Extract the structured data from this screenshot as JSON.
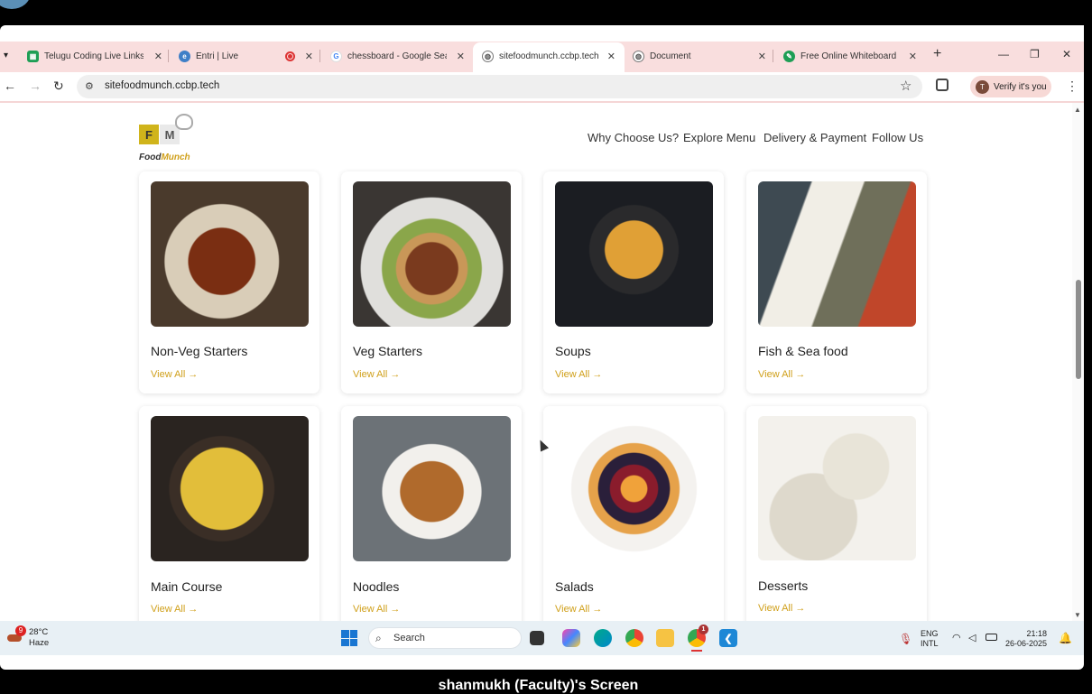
{
  "browser": {
    "tabs": [
      {
        "title": "Telugu Coding Live Links S"
      },
      {
        "title": "Entri | Live"
      },
      {
        "title": "chessboard - Google Searc"
      },
      {
        "title": "sitefoodmunch.ccbp.tech"
      },
      {
        "title": "Document"
      },
      {
        "title": "Free Online Whiteboard"
      }
    ],
    "new_tab": "+",
    "url": "sitefoodmunch.ccbp.tech",
    "profile_initial": "T",
    "profile_label": "Verify it's you"
  },
  "site": {
    "logo_f": "F",
    "logo_m": "M",
    "logo_text_a": "Food",
    "logo_text_b": "Munch",
    "nav": [
      "Why Choose Us?",
      "Explore Menu",
      "Delivery & Payment",
      "Follow Us"
    ]
  },
  "menu": {
    "view_all": "View All →",
    "items": [
      {
        "name": "Non-Veg Starters"
      },
      {
        "name": "Veg Starters"
      },
      {
        "name": "Soups"
      },
      {
        "name": "Fish & Sea food"
      },
      {
        "name": "Main Course"
      },
      {
        "name": "Noodles"
      },
      {
        "name": "Salads"
      },
      {
        "name": "Desserts"
      }
    ]
  },
  "taskbar": {
    "weather_badge": "9",
    "temperature": "28°C",
    "condition": "Haze",
    "search": "Search",
    "lang_1": "ENG",
    "lang_2": "INTL",
    "time": "21:18",
    "date": "26-06-2025",
    "chrome_badge": "1"
  },
  "caption": "shanmukh (Faculty)'s Screen",
  "colors": {
    "accent": "#d0a01b",
    "tabstrip": "#f9dede"
  }
}
